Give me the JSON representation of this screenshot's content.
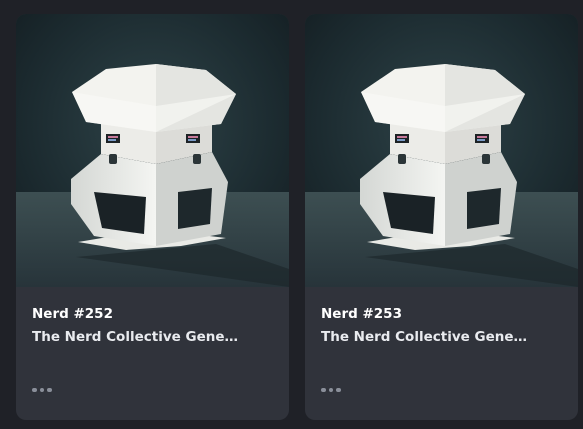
{
  "cards": [
    {
      "name": "Nerd #252",
      "collection": "The Nerd Collective Gene…",
      "image_icon": "hexagon-robot-image",
      "more_icon": "more-horizontal-icon"
    },
    {
      "name": "Nerd #253",
      "collection": "The Nerd Collective Gene…",
      "image_icon": "hexagon-robot-image",
      "more_icon": "more-horizontal-icon"
    }
  ],
  "colors": {
    "page_background": "#1f2127",
    "card_background": "#30333b",
    "image_background": "#1c2b30",
    "text_primary": "#ffffff",
    "dots": "#8a8f9a"
  }
}
